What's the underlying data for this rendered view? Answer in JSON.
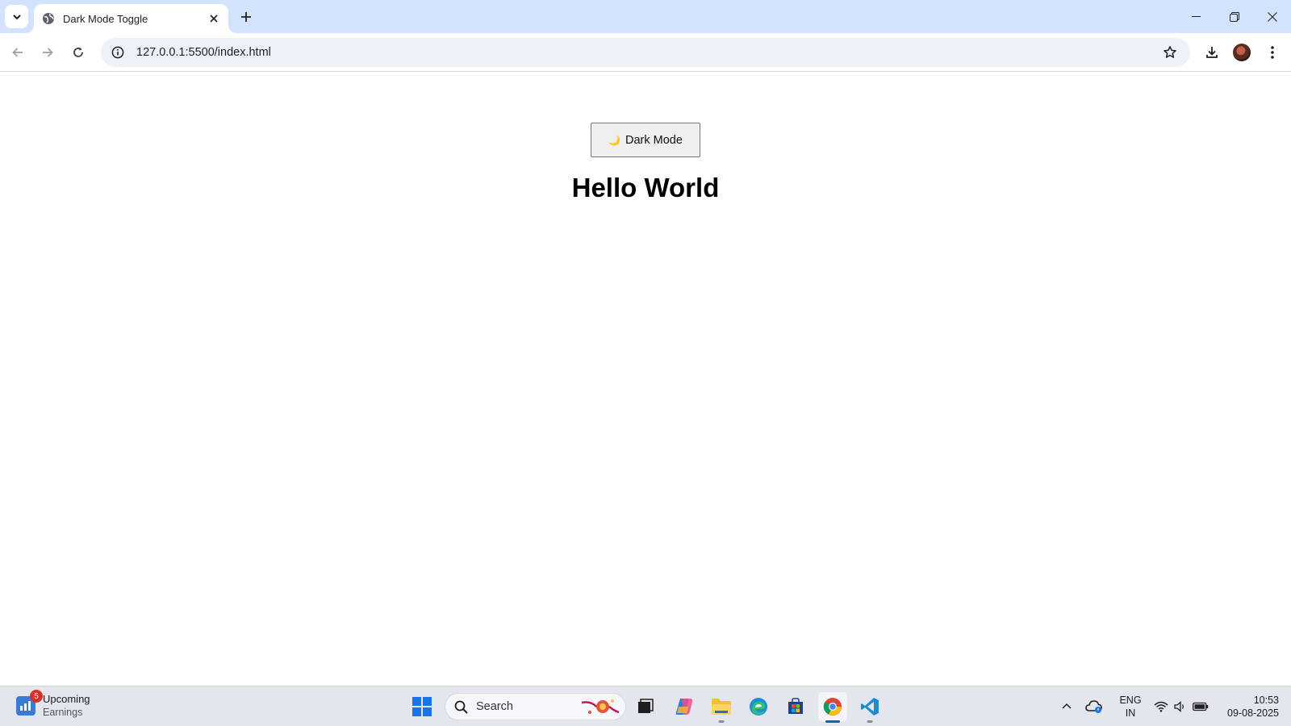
{
  "browser": {
    "tab": {
      "title": "Dark Mode Toggle"
    },
    "address": {
      "url": "127.0.0.1:5500/index.html"
    }
  },
  "page": {
    "toggle_label": "Dark Mode",
    "toggle_icon": "🌙",
    "heading": "Hello World"
  },
  "taskbar": {
    "widget": {
      "badge": "5",
      "title": "Upcoming",
      "subtitle": "Earnings"
    },
    "search_label": "Search",
    "apps": [
      "start-icon",
      "search-icon",
      "task-view-icon",
      "copilot-icon",
      "file-explorer-icon",
      "edge-icon",
      "store-icon",
      "chrome-icon",
      "vscode-icon"
    ],
    "tray": {
      "lang_line1": "ENG",
      "lang_line2": "IN",
      "time": "10:53",
      "date": "09-08-2025"
    }
  },
  "colors": {
    "tabbar_bg": "#d3e3fd",
    "omnibox_bg": "#eef1f7",
    "taskbar_bg": "#e3e6ec",
    "accent": "#0a62c8"
  }
}
